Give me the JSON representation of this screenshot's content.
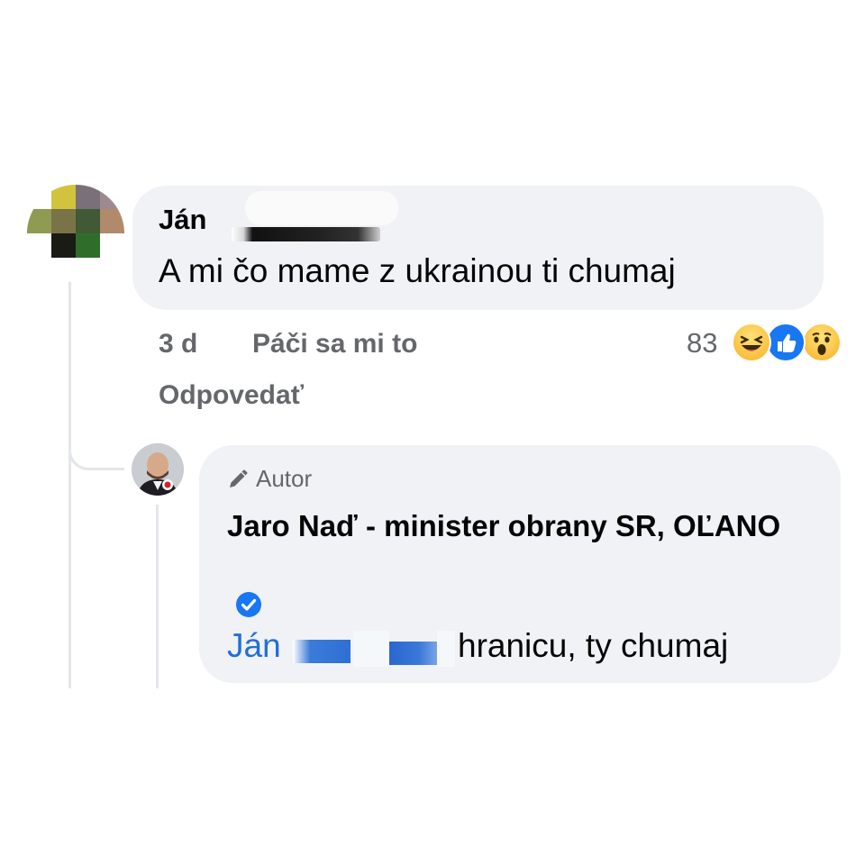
{
  "comment": {
    "author_name": "Ján",
    "text": "A mi čo mame z ukrainou ti chumaj",
    "time": "3 d",
    "like_label": "Páči sa mi to",
    "reply_label": "Odpovedať",
    "reaction_count": "83",
    "reactions": [
      "haha-icon",
      "like-icon",
      "wow-icon"
    ]
  },
  "reply": {
    "badge_label": "Autor",
    "author_name": "Jaro Naď - minister obrany SR, OĽANO",
    "mention": "Ján",
    "text": "hranicu, ty chumaj"
  },
  "colors": {
    "bubble": "#f0f2f5",
    "meta_text": "#65676b",
    "link_blue": "#216fdb",
    "like_blue": "#1877f2",
    "thread_line": "#e4e6eb"
  }
}
